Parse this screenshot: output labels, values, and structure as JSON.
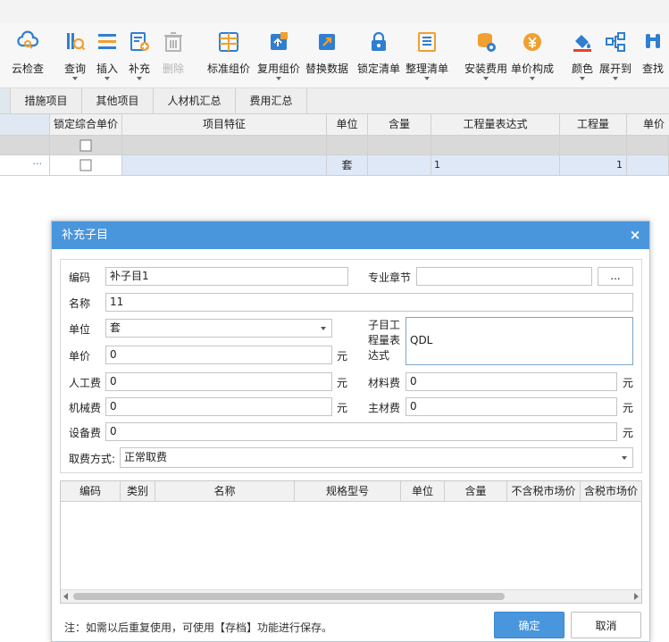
{
  "toolbar": {
    "items": [
      {
        "label": "云检查",
        "icon": "cloud-check-icon",
        "has_arrow": false,
        "disabled": false
      },
      {
        "label": "查询",
        "icon": "query-icon",
        "has_arrow": true,
        "disabled": false
      },
      {
        "label": "插入",
        "icon": "insert-icon",
        "has_arrow": true,
        "disabled": false
      },
      {
        "label": "补充",
        "icon": "supplement-icon",
        "has_arrow": true,
        "disabled": false
      },
      {
        "label": "删除",
        "icon": "trash-icon",
        "has_arrow": false,
        "disabled": true
      },
      {
        "label": "标准组价",
        "icon": "standard-pricing-icon",
        "has_arrow": false,
        "disabled": false
      },
      {
        "label": "复用组价",
        "icon": "reuse-pricing-icon",
        "has_arrow": true,
        "disabled": false
      },
      {
        "label": "替换数据",
        "icon": "replace-data-icon",
        "has_arrow": false,
        "disabled": false
      },
      {
        "label": "锁定清单",
        "icon": "lock-icon",
        "has_arrow": false,
        "disabled": false
      },
      {
        "label": "整理清单",
        "icon": "organize-list-icon",
        "has_arrow": true,
        "disabled": false
      },
      {
        "label": "安装费用",
        "icon": "install-fee-icon",
        "has_arrow": true,
        "disabled": false
      },
      {
        "label": "单价构成",
        "icon": "unit-price-icon",
        "has_arrow": true,
        "disabled": false
      },
      {
        "label": "颜色",
        "icon": "color-bucket-icon",
        "has_arrow": true,
        "disabled": false
      },
      {
        "label": "展开到",
        "icon": "expand-tree-icon",
        "has_arrow": true,
        "disabled": false
      },
      {
        "label": "查找",
        "icon": "binoculars-icon",
        "has_arrow": false,
        "disabled": false
      }
    ]
  },
  "tabs": [
    "措施项目",
    "其他项目",
    "人材机汇总",
    "费用汇总"
  ],
  "grid": {
    "headers": [
      "锁定综合单价",
      "项目特征",
      "单位",
      "含量",
      "工程量表达式",
      "工程量",
      "单价"
    ],
    "row2": {
      "unit": "套",
      "expr": "1",
      "qty": "1",
      "ellipsis": "···"
    }
  },
  "dialog": {
    "title": "补充子目",
    "close": "×",
    "code_label": "编码",
    "code_value": "补子目1",
    "chapter_label": "专业章节",
    "chapter_value": "",
    "chapter_btn": "...",
    "name_label": "名称",
    "name_value": "11",
    "unit_label": "单位",
    "unit_value": "套",
    "expr_label": "子目工程量表达式",
    "expr_value": "QDL",
    "price_label": "单价",
    "price_value": "0",
    "labor_label": "人工费",
    "labor_value": "0",
    "material_label": "材料费",
    "material_value": "0",
    "machine_label": "机械费",
    "machine_value": "0",
    "main_material_label": "主材费",
    "main_material_value": "0",
    "equipment_label": "设备费",
    "equipment_value": "0",
    "currency": "元",
    "fee_mode_label": "取费方式:",
    "fee_mode_value": "正常取费",
    "table_headers": [
      "编码",
      "类别",
      "名称",
      "规格型号",
      "单位",
      "含量",
      "不含税市场价",
      "含税市场价"
    ],
    "note": "注：如需以后重复使用，可使用【存档】功能进行保存。",
    "ok": "确定",
    "cancel": "取消"
  },
  "colors": {
    "accent": "#4a96dd",
    "icon_blue": "#2f7fd0",
    "icon_orange": "#f0a030"
  }
}
